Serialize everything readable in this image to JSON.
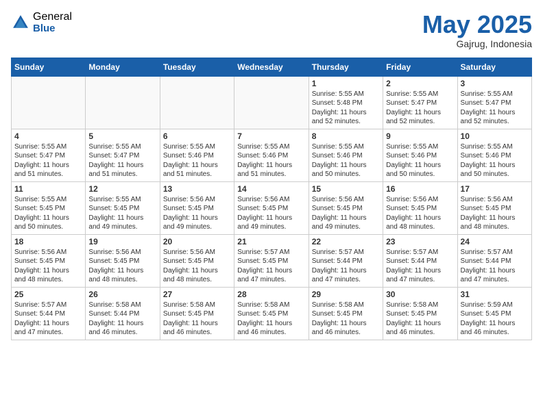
{
  "logo": {
    "general": "General",
    "blue": "Blue"
  },
  "title": "May 2025",
  "location": "Gajrug, Indonesia",
  "days_of_week": [
    "Sunday",
    "Monday",
    "Tuesday",
    "Wednesday",
    "Thursday",
    "Friday",
    "Saturday"
  ],
  "weeks": [
    [
      {
        "day": "",
        "info": ""
      },
      {
        "day": "",
        "info": ""
      },
      {
        "day": "",
        "info": ""
      },
      {
        "day": "",
        "info": ""
      },
      {
        "day": "1",
        "info": "Sunrise: 5:55 AM\nSunset: 5:48 PM\nDaylight: 11 hours\nand 52 minutes."
      },
      {
        "day": "2",
        "info": "Sunrise: 5:55 AM\nSunset: 5:47 PM\nDaylight: 11 hours\nand 52 minutes."
      },
      {
        "day": "3",
        "info": "Sunrise: 5:55 AM\nSunset: 5:47 PM\nDaylight: 11 hours\nand 52 minutes."
      }
    ],
    [
      {
        "day": "4",
        "info": "Sunrise: 5:55 AM\nSunset: 5:47 PM\nDaylight: 11 hours\nand 51 minutes."
      },
      {
        "day": "5",
        "info": "Sunrise: 5:55 AM\nSunset: 5:47 PM\nDaylight: 11 hours\nand 51 minutes."
      },
      {
        "day": "6",
        "info": "Sunrise: 5:55 AM\nSunset: 5:46 PM\nDaylight: 11 hours\nand 51 minutes."
      },
      {
        "day": "7",
        "info": "Sunrise: 5:55 AM\nSunset: 5:46 PM\nDaylight: 11 hours\nand 51 minutes."
      },
      {
        "day": "8",
        "info": "Sunrise: 5:55 AM\nSunset: 5:46 PM\nDaylight: 11 hours\nand 50 minutes."
      },
      {
        "day": "9",
        "info": "Sunrise: 5:55 AM\nSunset: 5:46 PM\nDaylight: 11 hours\nand 50 minutes."
      },
      {
        "day": "10",
        "info": "Sunrise: 5:55 AM\nSunset: 5:46 PM\nDaylight: 11 hours\nand 50 minutes."
      }
    ],
    [
      {
        "day": "11",
        "info": "Sunrise: 5:55 AM\nSunset: 5:45 PM\nDaylight: 11 hours\nand 50 minutes."
      },
      {
        "day": "12",
        "info": "Sunrise: 5:55 AM\nSunset: 5:45 PM\nDaylight: 11 hours\nand 49 minutes."
      },
      {
        "day": "13",
        "info": "Sunrise: 5:56 AM\nSunset: 5:45 PM\nDaylight: 11 hours\nand 49 minutes."
      },
      {
        "day": "14",
        "info": "Sunrise: 5:56 AM\nSunset: 5:45 PM\nDaylight: 11 hours\nand 49 minutes."
      },
      {
        "day": "15",
        "info": "Sunrise: 5:56 AM\nSunset: 5:45 PM\nDaylight: 11 hours\nand 49 minutes."
      },
      {
        "day": "16",
        "info": "Sunrise: 5:56 AM\nSunset: 5:45 PM\nDaylight: 11 hours\nand 48 minutes."
      },
      {
        "day": "17",
        "info": "Sunrise: 5:56 AM\nSunset: 5:45 PM\nDaylight: 11 hours\nand 48 minutes."
      }
    ],
    [
      {
        "day": "18",
        "info": "Sunrise: 5:56 AM\nSunset: 5:45 PM\nDaylight: 11 hours\nand 48 minutes."
      },
      {
        "day": "19",
        "info": "Sunrise: 5:56 AM\nSunset: 5:45 PM\nDaylight: 11 hours\nand 48 minutes."
      },
      {
        "day": "20",
        "info": "Sunrise: 5:56 AM\nSunset: 5:45 PM\nDaylight: 11 hours\nand 48 minutes."
      },
      {
        "day": "21",
        "info": "Sunrise: 5:57 AM\nSunset: 5:45 PM\nDaylight: 11 hours\nand 47 minutes."
      },
      {
        "day": "22",
        "info": "Sunrise: 5:57 AM\nSunset: 5:44 PM\nDaylight: 11 hours\nand 47 minutes."
      },
      {
        "day": "23",
        "info": "Sunrise: 5:57 AM\nSunset: 5:44 PM\nDaylight: 11 hours\nand 47 minutes."
      },
      {
        "day": "24",
        "info": "Sunrise: 5:57 AM\nSunset: 5:44 PM\nDaylight: 11 hours\nand 47 minutes."
      }
    ],
    [
      {
        "day": "25",
        "info": "Sunrise: 5:57 AM\nSunset: 5:44 PM\nDaylight: 11 hours\nand 47 minutes."
      },
      {
        "day": "26",
        "info": "Sunrise: 5:58 AM\nSunset: 5:44 PM\nDaylight: 11 hours\nand 46 minutes."
      },
      {
        "day": "27",
        "info": "Sunrise: 5:58 AM\nSunset: 5:45 PM\nDaylight: 11 hours\nand 46 minutes."
      },
      {
        "day": "28",
        "info": "Sunrise: 5:58 AM\nSunset: 5:45 PM\nDaylight: 11 hours\nand 46 minutes."
      },
      {
        "day": "29",
        "info": "Sunrise: 5:58 AM\nSunset: 5:45 PM\nDaylight: 11 hours\nand 46 minutes."
      },
      {
        "day": "30",
        "info": "Sunrise: 5:58 AM\nSunset: 5:45 PM\nDaylight: 11 hours\nand 46 minutes."
      },
      {
        "day": "31",
        "info": "Sunrise: 5:59 AM\nSunset: 5:45 PM\nDaylight: 11 hours\nand 46 minutes."
      }
    ]
  ]
}
